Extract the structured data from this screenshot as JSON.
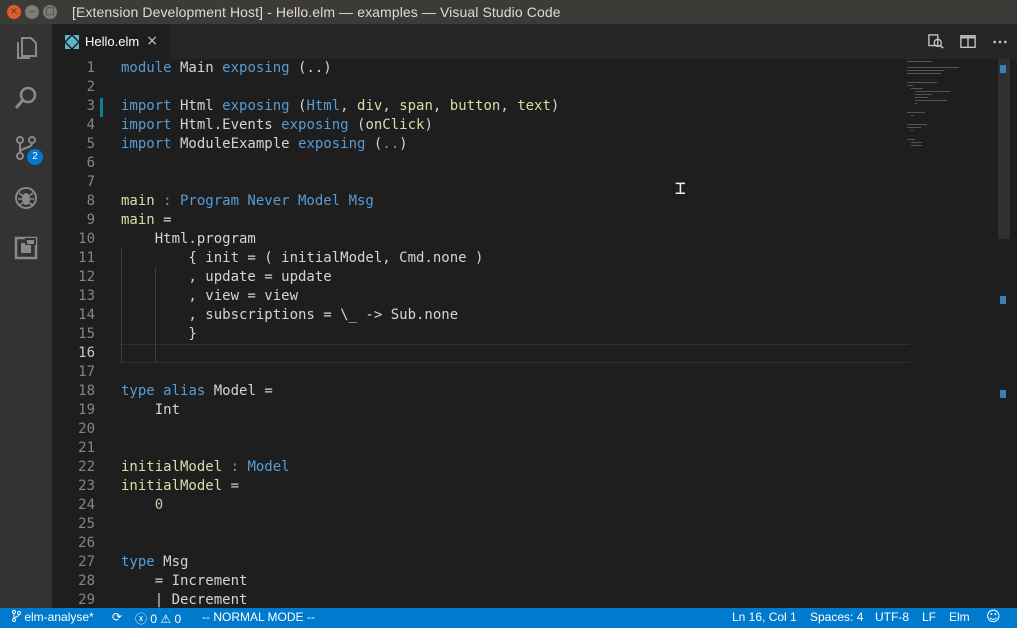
{
  "window": {
    "title": "[Extension Development Host] - Hello.elm — examples — Visual Studio Code"
  },
  "activity_bar": {
    "items": [
      {
        "name": "explorer",
        "icon": "files-icon"
      },
      {
        "name": "search",
        "icon": "search-icon"
      },
      {
        "name": "source-control",
        "icon": "source-control-icon",
        "badge": "2"
      },
      {
        "name": "debug",
        "icon": "debug-icon"
      },
      {
        "name": "extensions",
        "icon": "extensions-icon"
      }
    ]
  },
  "tabs": [
    {
      "label": "Hello.elm",
      "icon": "elm-file-icon",
      "active": true
    }
  ],
  "editor_actions": [
    "open-changes-icon",
    "split-editor-icon",
    "more-actions-icon"
  ],
  "editor": {
    "current_line": "16",
    "lines": [
      {
        "n": "1",
        "code": "module Main exposing (..)"
      },
      {
        "n": "2",
        "code": ""
      },
      {
        "n": "3",
        "code": "import Html exposing (Html, div, span, button, text)"
      },
      {
        "n": "4",
        "code": "import Html.Events exposing (onClick)"
      },
      {
        "n": "5",
        "code": "import ModuleExample exposing (..)"
      },
      {
        "n": "6",
        "code": ""
      },
      {
        "n": "7",
        "code": ""
      },
      {
        "n": "8",
        "code": "main : Program Never Model Msg"
      },
      {
        "n": "9",
        "code": "main ="
      },
      {
        "n": "10",
        "code": "    Html.program"
      },
      {
        "n": "11",
        "code": "        { init = ( initialModel, Cmd.none )"
      },
      {
        "n": "12",
        "code": "        , update = update"
      },
      {
        "n": "13",
        "code": "        , view = view"
      },
      {
        "n": "14",
        "code": "        , subscriptions = \\_ -> Sub.none"
      },
      {
        "n": "15",
        "code": "        }"
      },
      {
        "n": "16",
        "code": ""
      },
      {
        "n": "17",
        "code": ""
      },
      {
        "n": "18",
        "code": "type alias Model ="
      },
      {
        "n": "19",
        "code": "    Int"
      },
      {
        "n": "20",
        "code": ""
      },
      {
        "n": "21",
        "code": ""
      },
      {
        "n": "22",
        "code": "initialModel : Model"
      },
      {
        "n": "23",
        "code": "initialModel ="
      },
      {
        "n": "24",
        "code": "    0"
      },
      {
        "n": "25",
        "code": ""
      },
      {
        "n": "26",
        "code": ""
      },
      {
        "n": "27",
        "code": "type Msg"
      },
      {
        "n": "28",
        "code": "    = Increment"
      },
      {
        "n": "29",
        "code": "    | Decrement"
      }
    ]
  },
  "statusbar": {
    "branch": "elm-analyse*",
    "errors": "0",
    "warnings": "0",
    "mode": "-- NORMAL MODE --",
    "position": "Ln 16, Col 1",
    "spaces": "Spaces: 4",
    "encoding": "UTF-8",
    "eol": "LF",
    "language": "Elm"
  },
  "colors": {
    "statusbar": "#007acc",
    "keyword": "#569cd6",
    "function": "#dcdcaa",
    "type": "#4ec9b0"
  }
}
